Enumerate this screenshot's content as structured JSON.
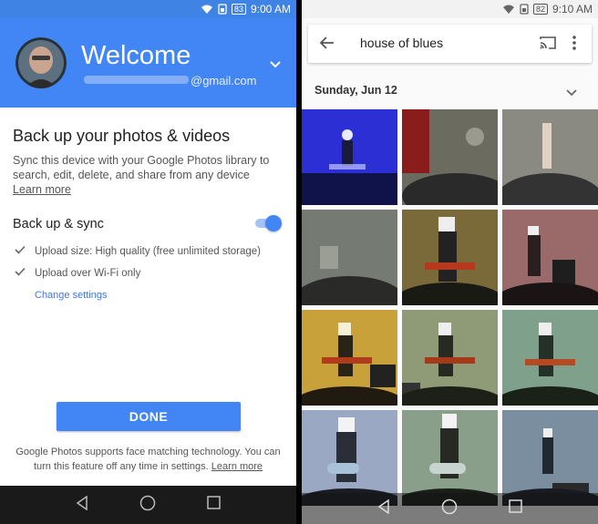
{
  "left": {
    "status": {
      "battery": "83",
      "time": "9:00 AM"
    },
    "header": {
      "title": "Welcome",
      "email_suffix": "@gmail.com"
    },
    "backup": {
      "title": "Back up your photos & videos",
      "description": "Sync this device with your Google Photos library to search, edit, delete, and share from any device",
      "learn_more": "Learn more"
    },
    "sync": {
      "label": "Back up & sync",
      "enabled": true,
      "options": [
        "Upload size: High quality (free unlimited storage)",
        "Upload over Wi-Fi only"
      ],
      "change_settings": "Change settings"
    },
    "done_label": "DONE",
    "face_note": "Google Photos supports face matching technology. You can turn this feature off any time in settings.",
    "face_learn_more": "Learn more",
    "colors": {
      "header": "#4285f4",
      "accent": "#4285f4"
    }
  },
  "right": {
    "status": {
      "battery": "82",
      "time": "9:10 AM"
    },
    "search": {
      "query": "house of blues"
    },
    "date_header": "Sunday, Jun 12"
  }
}
